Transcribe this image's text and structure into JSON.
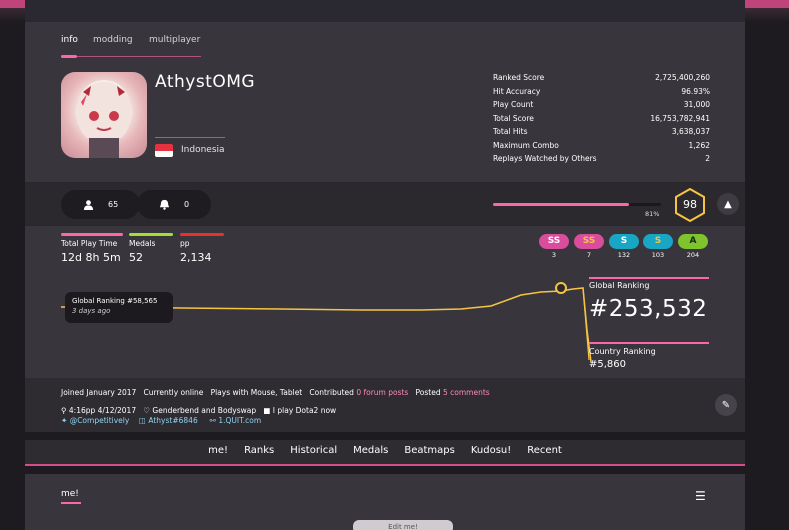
{
  "tabs": [
    {
      "label": "info"
    },
    {
      "label": "modding"
    },
    {
      "label": "multiplayer"
    }
  ],
  "user": {
    "name": "AthystOMG",
    "country": "Indonesia"
  },
  "stats": [
    {
      "label": "Ranked Score",
      "value": "2,725,400,260"
    },
    {
      "label": "Hit Accuracy",
      "value": "96.93%"
    },
    {
      "label": "Play Count",
      "value": "31,000"
    },
    {
      "label": "Total Score",
      "value": "16,753,782,941"
    },
    {
      "label": "Total Hits",
      "value": "3,638,037"
    },
    {
      "label": "Maximum Combo",
      "value": "1,262"
    },
    {
      "label": "Replays Watched by Others",
      "value": "2"
    }
  ],
  "social": {
    "followers": "65",
    "subscribers": "0"
  },
  "level": {
    "value": "98",
    "progress_label": "81%",
    "progress": 0.81
  },
  "mini_stats": [
    {
      "label": "Total Play Time",
      "value": "12d 8h 5m",
      "color": "#ff66aa"
    },
    {
      "label": "Medals",
      "value": "52",
      "color": "#a4e02a"
    },
    {
      "label": "pp",
      "value": "2,134",
      "color": "#e83030"
    }
  ],
  "grades": [
    {
      "label": "SS",
      "count": "3",
      "color": "#d94d9c",
      "text_color": "#ffffff"
    },
    {
      "label": "SS",
      "count": "7",
      "color": "#d94d9c",
      "text_color": "#f5c542"
    },
    {
      "label": "S",
      "count": "132",
      "color": "#19a5c4",
      "text_color": "#ffffff"
    },
    {
      "label": "S",
      "count": "103",
      "color": "#19a5c4",
      "text_color": "#f5c542"
    },
    {
      "label": "A",
      "count": "204",
      "color": "#7fc32d",
      "text_color": "#1a2a10"
    }
  ],
  "graph": {
    "tooltip_title": "Global Ranking #58,565",
    "tooltip_sub": "3 days ago"
  },
  "ranking": {
    "global_label": "Global Ranking",
    "global_value": "#253,532",
    "country_label": "Country Ranking",
    "country_value": "#5,860"
  },
  "meta": {
    "joined": "Joined January 2017",
    "status": "Currently online",
    "plays_with": "Plays with Mouse, Tablet",
    "contributed_prefix": "Contributed",
    "forum_posts": "0 forum posts",
    "posted_prefix": "Posted",
    "comments": "5 comments",
    "location": "4:16pp 4/12/2017",
    "interests": "Genderbend and Bodyswap",
    "occupation": "I play Dota2 now",
    "twitter": "@Competitively",
    "discord": "Athyst#6846",
    "website": "1.QUIT.com"
  },
  "nav": [
    "me!",
    "Ranks",
    "Historical",
    "Medals",
    "Beatmaps",
    "Kudosu!",
    "Recent"
  ],
  "me_section": {
    "title": "me!",
    "edit_label": "Edit me!"
  }
}
